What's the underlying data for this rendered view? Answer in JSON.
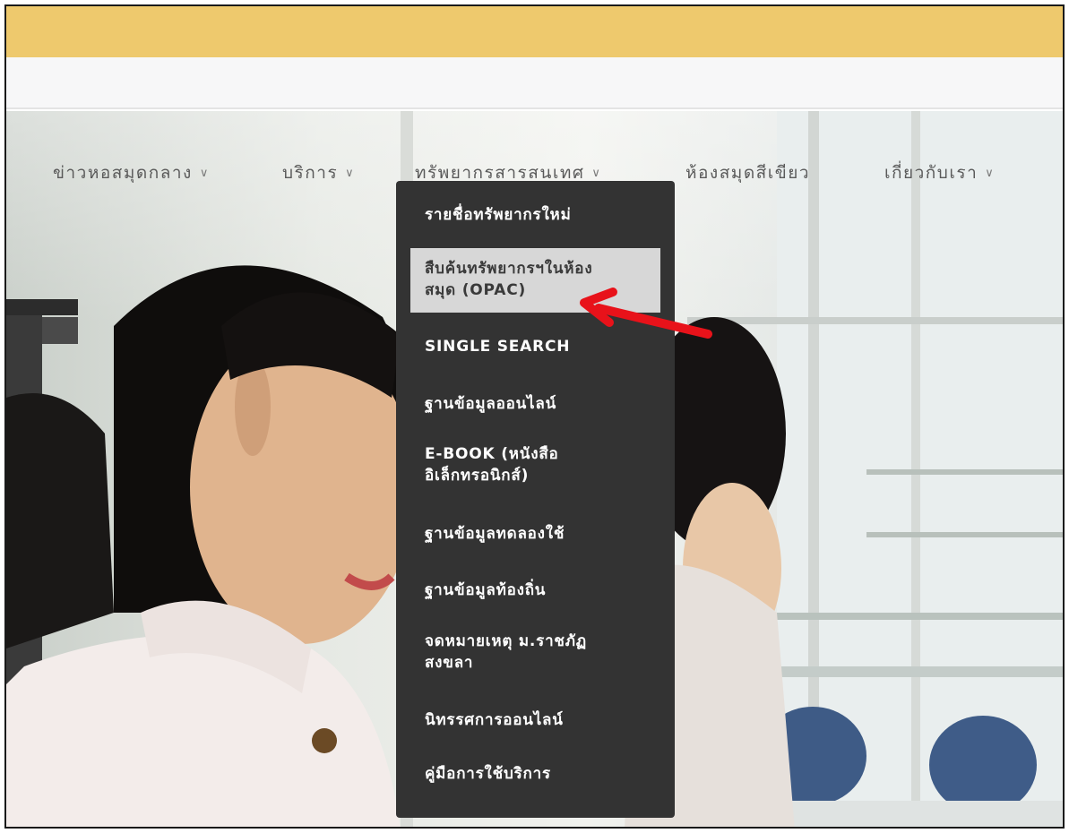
{
  "nav": {
    "items": [
      {
        "label": "ข่าวหอสมุดกลาง",
        "has_submenu": true
      },
      {
        "label": "บริการ",
        "has_submenu": true
      },
      {
        "label": "ทรัพยากรสารสนเทศ",
        "has_submenu": true
      },
      {
        "label": "ห้องสมุดสีเขียว",
        "has_submenu": false
      },
      {
        "label": "เกี่ยวกับเรา",
        "has_submenu": true
      }
    ],
    "chevron": "∨"
  },
  "dropdown": {
    "items": [
      {
        "label": "รายชื่อทรัพยากรใหม่"
      },
      {
        "label": "สืบค้นทรัพยากรฯในห้องสมุด (OPAC)",
        "line1": "สืบค้นทรัพยากรฯในห้อง",
        "line2": "สมุด (OPAC)",
        "highlighted": true
      },
      {
        "label": "SINGLE SEARCH"
      },
      {
        "label": "ฐานข้อมูลออนไลน์"
      },
      {
        "label": "E-BOOK (หนังสืออิเล็กทรอนิกส์)",
        "line1": "E-BOOK (หนังสือ",
        "line2": "อิเล็กทรอนิกส์)"
      },
      {
        "label": "ฐานข้อมูลทดลองใช้"
      },
      {
        "label": "ฐานข้อมูลท้องถิ่น"
      },
      {
        "label": "จดหมายเหตุ ม.ราชภัฏสงขลา",
        "line1": "จดหมายเหตุ ม.ราชภัฏ",
        "line2": "สงขลา"
      },
      {
        "label": "นิทรรศการออนไลน์"
      },
      {
        "label": "คู่มือการใช้บริการ"
      }
    ]
  },
  "colors": {
    "topbar": "#eec96d",
    "dropdown_bg": "#333333",
    "highlight_bg": "#d7d7d7",
    "annotation_arrow": "#e8121a"
  }
}
